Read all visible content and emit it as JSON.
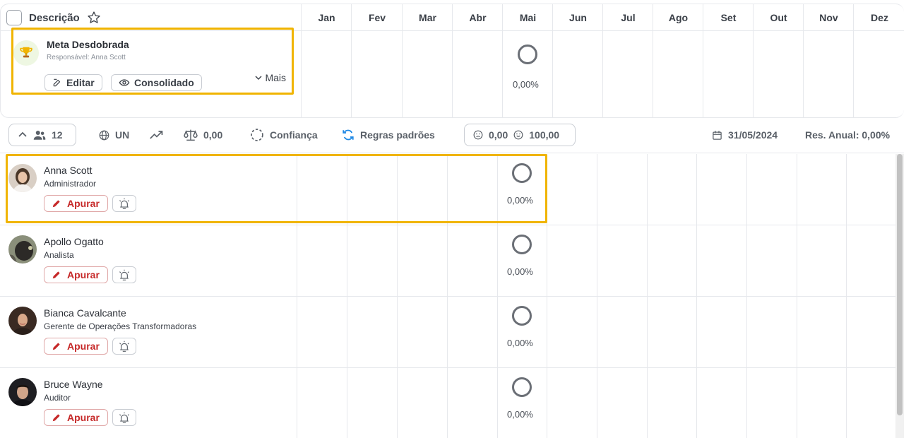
{
  "header": {
    "description_label": "Descrição",
    "months": [
      "Jan",
      "Fev",
      "Mar",
      "Abr",
      "Mai",
      "Jun",
      "Jul",
      "Ago",
      "Set",
      "Out",
      "Nov",
      "Dez"
    ]
  },
  "goal": {
    "title": "Meta Desdobrada",
    "responsible": "Responsável: Anna Scott",
    "edit_label": "Editar",
    "consolidated_label": "Consolidado",
    "more_label": "Mais",
    "may_value": "0,00%"
  },
  "toolbar": {
    "people_count": "12",
    "unit": "UN",
    "weight_value": "0,00",
    "confidence_label": "Confiança",
    "rules_label": "Regras padrões",
    "range_min": "0,00",
    "range_max": "100,00",
    "date": "31/05/2024",
    "annual_result": "Res. Anual: 0,00%"
  },
  "people": [
    {
      "name": "Anna Scott",
      "role": "Administrador",
      "apurar_label": "Apurar",
      "may_value": "0,00%"
    },
    {
      "name": "Apollo Ogatto",
      "role": "Analista",
      "apurar_label": "Apurar",
      "may_value": "0,00%"
    },
    {
      "name": "Bianca Cavalcante",
      "role": "Gerente de Operações Transformadoras",
      "apurar_label": "Apurar",
      "may_value": "0,00%"
    },
    {
      "name": "Bruce Wayne",
      "role": "Auditor",
      "apurar_label": "Apurar",
      "may_value": "0,00%"
    }
  ],
  "colors": {
    "highlight": "#f0b400",
    "apurar": "#c62828",
    "rules_icon": "#1e88e5"
  }
}
